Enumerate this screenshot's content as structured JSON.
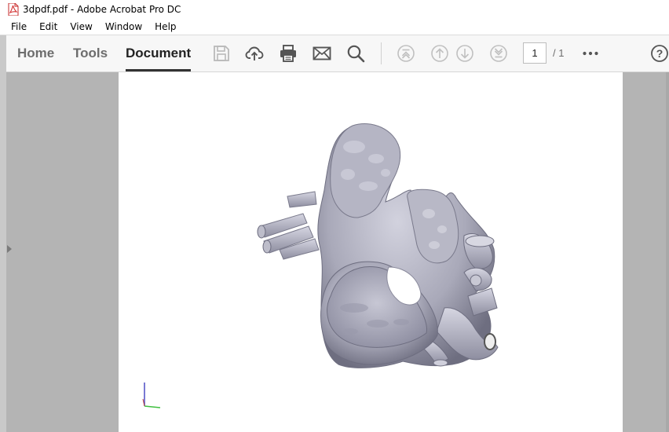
{
  "window": {
    "title": "3dpdf.pdf - Adobe Acrobat Pro DC",
    "icon": "pdf-icon"
  },
  "menu": [
    "File",
    "Edit",
    "View",
    "Window",
    "Help"
  ],
  "tabs": [
    {
      "label": "Home",
      "active": false
    },
    {
      "label": "Tools",
      "active": false
    },
    {
      "label": "Document",
      "active": true
    }
  ],
  "toolbar_icons": [
    {
      "name": "save-icon",
      "enabled": false
    },
    {
      "name": "upload-cloud-icon",
      "enabled": true
    },
    {
      "name": "print-icon",
      "enabled": true
    },
    {
      "name": "email-icon",
      "enabled": true
    },
    {
      "name": "search-icon",
      "enabled": true
    },
    {
      "name": "first-page-icon",
      "enabled": false
    },
    {
      "name": "previous-page-icon",
      "enabled": false
    },
    {
      "name": "next-page-icon",
      "enabled": false
    },
    {
      "name": "last-page-icon",
      "enabled": false
    },
    {
      "name": "more-options-icon",
      "enabled": true
    },
    {
      "name": "help-icon",
      "enabled": true
    }
  ],
  "pagination": {
    "current": "1",
    "total": "/ 1"
  },
  "document": {
    "content": "3d-heart-model",
    "axes_indicator": "xyz-axes-icon"
  },
  "colors": {
    "accent_tab_underline": "#333333",
    "viewer_background": "#b4b4b4",
    "model_surface": "#a9a9b9",
    "pdf_icon": "#d32f2f"
  }
}
